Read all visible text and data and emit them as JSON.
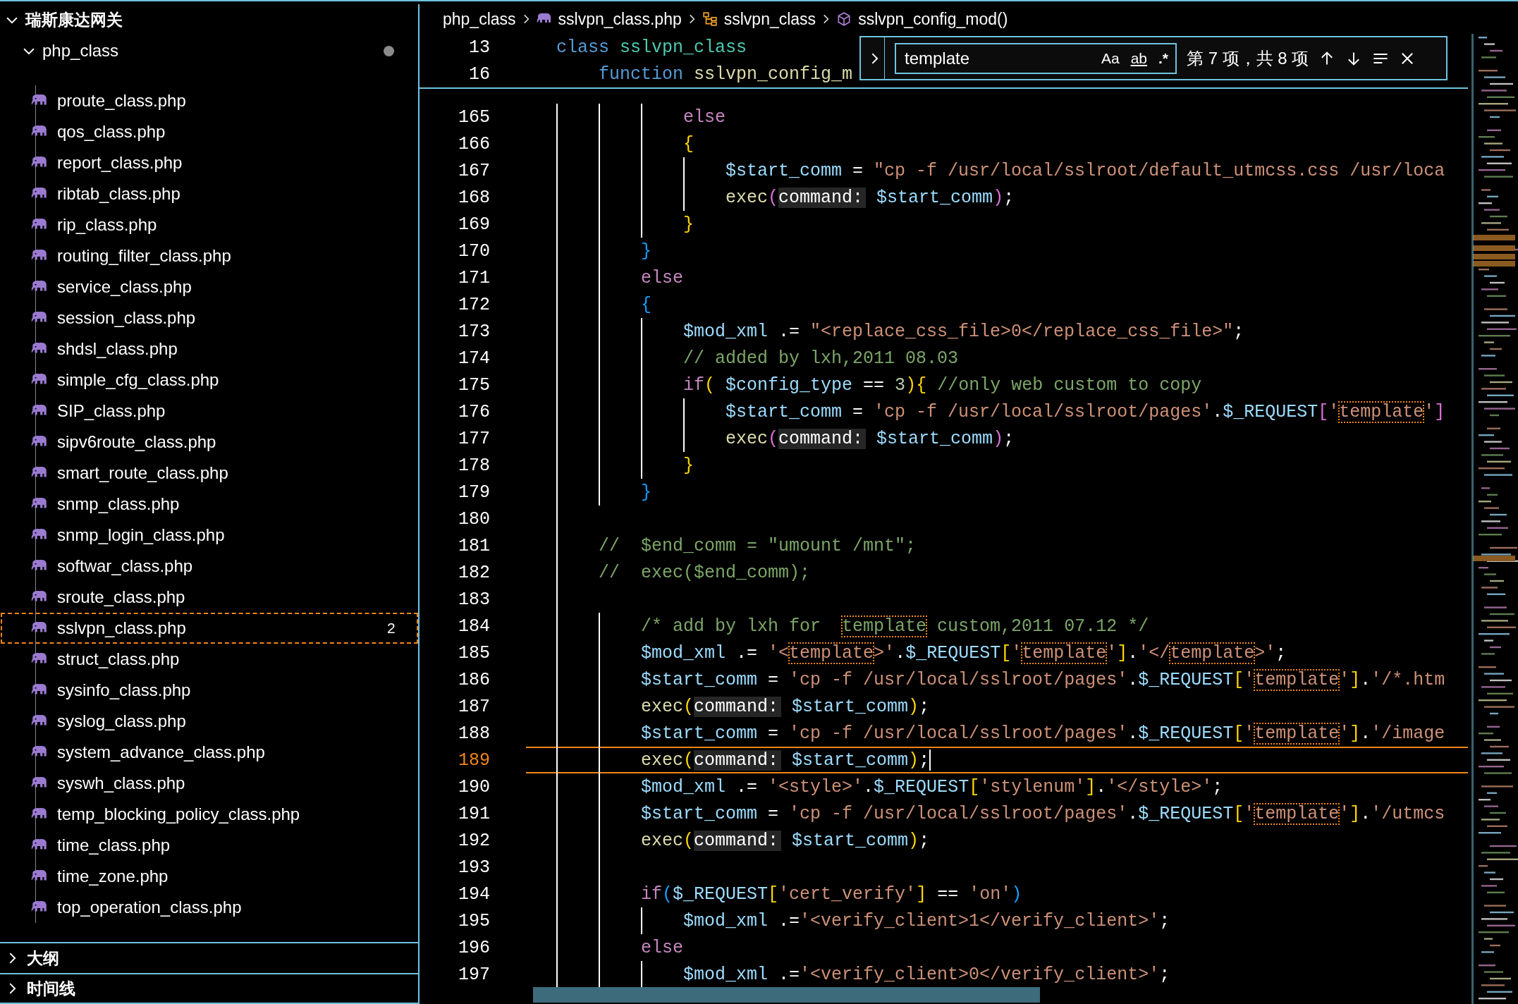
{
  "explorer": {
    "root": {
      "label": "瑞斯康达网关",
      "expanded": true
    },
    "folder": {
      "label": "php_class",
      "expanded": true,
      "modified": true
    },
    "files": [
      {
        "label": "proute_class.php",
        "selected": false
      },
      {
        "label": "qos_class.php",
        "selected": false
      },
      {
        "label": "report_class.php",
        "selected": false
      },
      {
        "label": "ribtab_class.php",
        "selected": false
      },
      {
        "label": "rip_class.php",
        "selected": false
      },
      {
        "label": "routing_filter_class.php",
        "selected": false
      },
      {
        "label": "service_class.php",
        "selected": false
      },
      {
        "label": "session_class.php",
        "selected": false
      },
      {
        "label": "shdsl_class.php",
        "selected": false
      },
      {
        "label": "simple_cfg_class.php",
        "selected": false
      },
      {
        "label": "SIP_class.php",
        "selected": false
      },
      {
        "label": "sipv6route_class.php",
        "selected": false
      },
      {
        "label": "smart_route_class.php",
        "selected": false
      },
      {
        "label": "snmp_class.php",
        "selected": false
      },
      {
        "label": "snmp_login_class.php",
        "selected": false
      },
      {
        "label": "softwar_class.php",
        "selected": false
      },
      {
        "label": "sroute_class.php",
        "selected": false
      },
      {
        "label": "sslvpn_class.php",
        "selected": true,
        "badge": "2"
      },
      {
        "label": "struct_class.php",
        "selected": false
      },
      {
        "label": "sysinfo_class.php",
        "selected": false
      },
      {
        "label": "syslog_class.php",
        "selected": false
      },
      {
        "label": "system_advance_class.php",
        "selected": false
      },
      {
        "label": "syswh_class.php",
        "selected": false
      },
      {
        "label": "temp_blocking_policy_class.php",
        "selected": false
      },
      {
        "label": "time_class.php",
        "selected": false
      },
      {
        "label": "time_zone.php",
        "selected": false
      },
      {
        "label": "top_operation_class.php",
        "selected": false
      }
    ],
    "sections": [
      {
        "label": "大纲",
        "expanded": false
      },
      {
        "label": "时间线",
        "expanded": false
      }
    ]
  },
  "breadcrumbs": [
    {
      "label": "php_class",
      "kind": "folder"
    },
    {
      "label": "sslvpn_class.php",
      "kind": "php"
    },
    {
      "label": "sslvpn_class",
      "kind": "class"
    },
    {
      "label": "sslvpn_config_mod()",
      "kind": "method"
    }
  ],
  "sticky": [
    {
      "number": "13",
      "tokens": [
        {
          "kind": "storage",
          "text": "class"
        },
        {
          "kind": "type",
          "text": " sslvpn_class"
        }
      ]
    },
    {
      "number": "16",
      "tokens": [
        {
          "kind": "storage",
          "text": "    function"
        },
        {
          "kind": "fn",
          "text": " sslvpn_config_m"
        }
      ]
    }
  ],
  "lines": [
    {
      "number": "165",
      "current": false,
      "tokens": [
        {
          "kind": "kw",
          "text": "            else"
        }
      ]
    },
    {
      "number": "166",
      "current": false,
      "tokens": [
        {
          "kind": "brace1",
          "text": "            {"
        }
      ]
    },
    {
      "number": "167",
      "current": false,
      "tokens": [
        {
          "kind": "var",
          "text": "                $start_comm"
        },
        {
          "kind": "plain",
          "text": " = "
        },
        {
          "kind": "str",
          "text": "\"cp -f /usr/local/sslroot/default_utmcss.css /usr/loca"
        }
      ]
    },
    {
      "number": "168",
      "current": false,
      "tokens": [
        {
          "kind": "fn",
          "text": "                exec"
        },
        {
          "kind": "brace2",
          "text": "("
        },
        {
          "kind": "hint",
          "text": "command:"
        },
        {
          "kind": "var",
          "text": " $start_comm"
        },
        {
          "kind": "brace2",
          "text": ")"
        },
        {
          "kind": "plain",
          "text": ";"
        }
      ]
    },
    {
      "number": "169",
      "current": false,
      "tokens": [
        {
          "kind": "brace1",
          "text": "            }"
        }
      ]
    },
    {
      "number": "170",
      "current": false,
      "tokens": [
        {
          "kind": "brace3",
          "text": "        }"
        }
      ]
    },
    {
      "number": "171",
      "current": false,
      "tokens": [
        {
          "kind": "kw",
          "text": "        else"
        }
      ]
    },
    {
      "number": "172",
      "current": false,
      "tokens": [
        {
          "kind": "brace3",
          "text": "        {"
        }
      ]
    },
    {
      "number": "173",
      "current": false,
      "tokens": [
        {
          "kind": "var",
          "text": "            $mod_xml"
        },
        {
          "kind": "plain",
          "text": " .= "
        },
        {
          "kind": "str",
          "text": "\"<replace_css_file>0</replace_css_file>\""
        },
        {
          "kind": "plain",
          "text": ";"
        }
      ]
    },
    {
      "number": "174",
      "current": false,
      "tokens": [
        {
          "kind": "comment",
          "text": "            // added by lxh,2011 08.03"
        }
      ]
    },
    {
      "number": "175",
      "current": false,
      "tokens": [
        {
          "kind": "kw",
          "text": "            if"
        },
        {
          "kind": "brace1",
          "text": "("
        },
        {
          "kind": "var",
          "text": " $config_type"
        },
        {
          "kind": "plain",
          "text": " == "
        },
        {
          "kind": "num",
          "text": "3"
        },
        {
          "kind": "brace1",
          "text": ")"
        },
        {
          "kind": "brace1",
          "text": "{"
        },
        {
          "kind": "comment",
          "text": " //only web custom to copy"
        }
      ]
    },
    {
      "number": "176",
      "current": false,
      "tokens": [
        {
          "kind": "var",
          "text": "                $start_comm"
        },
        {
          "kind": "plain",
          "text": " = "
        },
        {
          "kind": "str",
          "text": "'cp -f /usr/local/sslroot/pages'"
        },
        {
          "kind": "plain",
          "text": "."
        },
        {
          "kind": "var",
          "text": "$_REQUEST"
        },
        {
          "kind": "brace2",
          "text": "["
        },
        {
          "kind": "str",
          "text": "'"
        },
        {
          "kind": "str",
          "text": "template",
          "match": true
        },
        {
          "kind": "str",
          "text": "'"
        },
        {
          "kind": "brace2",
          "text": "]"
        }
      ]
    },
    {
      "number": "177",
      "current": false,
      "tokens": [
        {
          "kind": "fn",
          "text": "                exec"
        },
        {
          "kind": "brace2",
          "text": "("
        },
        {
          "kind": "hint",
          "text": "command:"
        },
        {
          "kind": "var",
          "text": " $start_comm"
        },
        {
          "kind": "brace2",
          "text": ")"
        },
        {
          "kind": "plain",
          "text": ";"
        }
      ]
    },
    {
      "number": "178",
      "current": false,
      "tokens": [
        {
          "kind": "brace1",
          "text": "            }"
        }
      ]
    },
    {
      "number": "179",
      "current": false,
      "tokens": [
        {
          "kind": "brace3",
          "text": "        }"
        }
      ]
    },
    {
      "number": "180",
      "current": false
    },
    {
      "number": "181",
      "current": false,
      "tokens": [
        {
          "kind": "comment",
          "text": "    //  $end_comm = \"umount /mnt\";"
        }
      ]
    },
    {
      "number": "182",
      "current": false,
      "tokens": [
        {
          "kind": "comment",
          "text": "    //  exec($end_comm);"
        }
      ]
    },
    {
      "number": "183",
      "current": false
    },
    {
      "number": "184",
      "current": false,
      "tokens": [
        {
          "kind": "comment",
          "text": "        /* add by lxh for  "
        },
        {
          "kind": "comment",
          "text": "template",
          "match": true
        },
        {
          "kind": "comment",
          "text": " custom,2011 07.12 */"
        }
      ]
    },
    {
      "number": "185",
      "current": false,
      "tokens": [
        {
          "kind": "var",
          "text": "        $mod_xml"
        },
        {
          "kind": "plain",
          "text": " .= "
        },
        {
          "kind": "str",
          "text": "'<"
        },
        {
          "kind": "str",
          "text": "template",
          "match": true
        },
        {
          "kind": "str",
          "text": ">'"
        },
        {
          "kind": "plain",
          "text": "."
        },
        {
          "kind": "var",
          "text": "$_REQUEST"
        },
        {
          "kind": "brace1",
          "text": "["
        },
        {
          "kind": "str",
          "text": "'"
        },
        {
          "kind": "str",
          "text": "template",
          "match": true
        },
        {
          "kind": "str",
          "text": "'"
        },
        {
          "kind": "brace1",
          "text": "]"
        },
        {
          "kind": "plain",
          "text": "."
        },
        {
          "kind": "str",
          "text": "'</"
        },
        {
          "kind": "str",
          "text": "template",
          "match": true
        },
        {
          "kind": "str",
          "text": ">'"
        },
        {
          "kind": "plain",
          "text": ";"
        }
      ]
    },
    {
      "number": "186",
      "current": false,
      "tokens": [
        {
          "kind": "var",
          "text": "        $start_comm"
        },
        {
          "kind": "plain",
          "text": " = "
        },
        {
          "kind": "str",
          "text": "'cp -f /usr/local/sslroot/pages'"
        },
        {
          "kind": "plain",
          "text": "."
        },
        {
          "kind": "var",
          "text": "$_REQUEST"
        },
        {
          "kind": "brace1",
          "text": "["
        },
        {
          "kind": "str",
          "text": "'"
        },
        {
          "kind": "str",
          "text": "template",
          "match": true
        },
        {
          "kind": "str",
          "text": "'"
        },
        {
          "kind": "brace1",
          "text": "]"
        },
        {
          "kind": "plain",
          "text": "."
        },
        {
          "kind": "str",
          "text": "'/*.htm"
        }
      ]
    },
    {
      "number": "187",
      "current": false,
      "tokens": [
        {
          "kind": "fn",
          "text": "        exec"
        },
        {
          "kind": "brace1",
          "text": "("
        },
        {
          "kind": "hint",
          "text": "command:"
        },
        {
          "kind": "var",
          "text": " $start_comm"
        },
        {
          "kind": "brace1",
          "text": ")"
        },
        {
          "kind": "plain",
          "text": ";"
        }
      ]
    },
    {
      "number": "188",
      "current": false,
      "tokens": [
        {
          "kind": "var",
          "text": "        $start_comm"
        },
        {
          "kind": "plain",
          "text": " = "
        },
        {
          "kind": "str",
          "text": "'cp -f /usr/local/sslroot/pages'"
        },
        {
          "kind": "plain",
          "text": "."
        },
        {
          "kind": "var",
          "text": "$_REQUEST"
        },
        {
          "kind": "brace1",
          "text": "["
        },
        {
          "kind": "str",
          "text": "'"
        },
        {
          "kind": "str",
          "text": "template",
          "match": true
        },
        {
          "kind": "str",
          "text": "'"
        },
        {
          "kind": "brace1",
          "text": "]"
        },
        {
          "kind": "plain",
          "text": "."
        },
        {
          "kind": "str",
          "text": "'/image"
        }
      ]
    },
    {
      "number": "189",
      "current": true,
      "tokens": [
        {
          "kind": "fn",
          "text": "        exec"
        },
        {
          "kind": "brace1",
          "text": "("
        },
        {
          "kind": "hint",
          "text": "command:"
        },
        {
          "kind": "var",
          "text": " $start_comm"
        },
        {
          "kind": "brace1",
          "text": ")"
        },
        {
          "kind": "plain",
          "text": ";"
        }
      ]
    },
    {
      "number": "190",
      "current": false,
      "tokens": [
        {
          "kind": "var",
          "text": "        $mod_xml"
        },
        {
          "kind": "plain",
          "text": " .= "
        },
        {
          "kind": "str",
          "text": "'<style>'"
        },
        {
          "kind": "plain",
          "text": "."
        },
        {
          "kind": "var",
          "text": "$_REQUEST"
        },
        {
          "kind": "brace1",
          "text": "["
        },
        {
          "kind": "str",
          "text": "'stylenum'"
        },
        {
          "kind": "brace1",
          "text": "]"
        },
        {
          "kind": "plain",
          "text": "."
        },
        {
          "kind": "str",
          "text": "'</style>'"
        },
        {
          "kind": "plain",
          "text": ";"
        }
      ]
    },
    {
      "number": "191",
      "current": false,
      "tokens": [
        {
          "kind": "var",
          "text": "        $start_comm"
        },
        {
          "kind": "plain",
          "text": " = "
        },
        {
          "kind": "str",
          "text": "'cp -f /usr/local/sslroot/pages'"
        },
        {
          "kind": "plain",
          "text": "."
        },
        {
          "kind": "var",
          "text": "$_REQUEST"
        },
        {
          "kind": "brace1",
          "text": "["
        },
        {
          "kind": "str",
          "text": "'"
        },
        {
          "kind": "str",
          "text": "template",
          "match": true
        },
        {
          "kind": "str",
          "text": "'"
        },
        {
          "kind": "brace1",
          "text": "]"
        },
        {
          "kind": "plain",
          "text": "."
        },
        {
          "kind": "str",
          "text": "'/utmcs"
        }
      ]
    },
    {
      "number": "192",
      "current": false,
      "tokens": [
        {
          "kind": "fn",
          "text": "        exec"
        },
        {
          "kind": "brace1",
          "text": "("
        },
        {
          "kind": "hint",
          "text": "command:"
        },
        {
          "kind": "var",
          "text": " $start_comm"
        },
        {
          "kind": "brace1",
          "text": ")"
        },
        {
          "kind": "plain",
          "text": ";"
        }
      ]
    },
    {
      "number": "193",
      "current": false
    },
    {
      "number": "194",
      "current": false,
      "tokens": [
        {
          "kind": "kw",
          "text": "        if"
        },
        {
          "kind": "brace3",
          "text": "("
        },
        {
          "kind": "var",
          "text": "$_REQUEST"
        },
        {
          "kind": "brace1",
          "text": "["
        },
        {
          "kind": "str",
          "text": "'cert_verify'"
        },
        {
          "kind": "brace1",
          "text": "]"
        },
        {
          "kind": "plain",
          "text": " == "
        },
        {
          "kind": "str",
          "text": "'on'"
        },
        {
          "kind": "brace3",
          "text": ")"
        }
      ]
    },
    {
      "number": "195",
      "current": false,
      "tokens": [
        {
          "kind": "var",
          "text": "            $mod_xml"
        },
        {
          "kind": "plain",
          "text": " .="
        },
        {
          "kind": "str",
          "text": "'<verify_client>1</verify_client>'"
        },
        {
          "kind": "plain",
          "text": ";"
        }
      ]
    },
    {
      "number": "196",
      "current": false,
      "tokens": [
        {
          "kind": "kw",
          "text": "        else"
        }
      ]
    },
    {
      "number": "197",
      "current": false,
      "tokens": [
        {
          "kind": "var",
          "text": "            $mod_xml"
        },
        {
          "kind": "plain",
          "text": " .="
        },
        {
          "kind": "str",
          "text": "'<verify_client>0</verify_client>'"
        },
        {
          "kind": "plain",
          "text": ";"
        }
      ]
    }
  ],
  "find": {
    "expanded": false,
    "value": "template",
    "options": [
      {
        "kind": "case",
        "text": "Aa"
      },
      {
        "kind": "word",
        "text": "ab"
      },
      {
        "kind": "regex",
        "text": ".*"
      }
    ],
    "count": "第 7 项，共 8 项"
  }
}
